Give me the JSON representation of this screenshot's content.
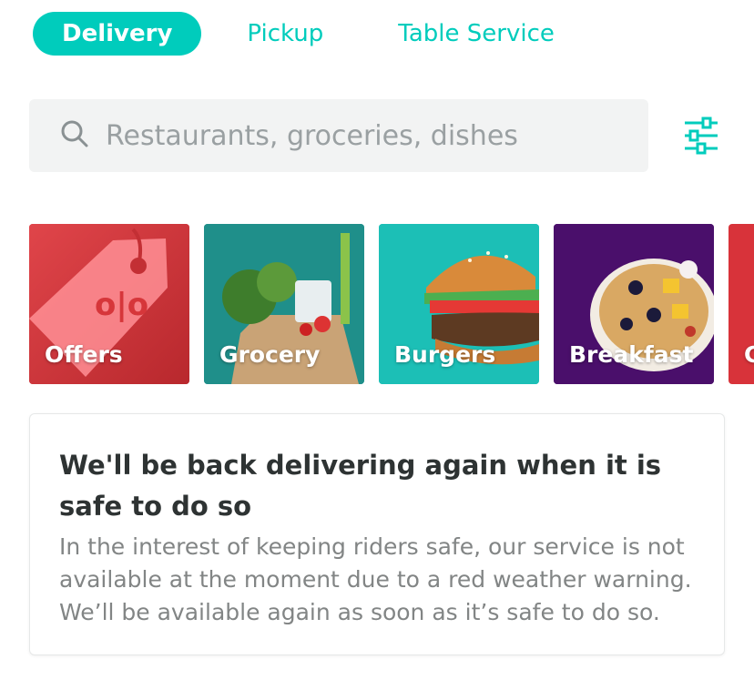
{
  "tabs": [
    {
      "label": "Delivery",
      "active": true
    },
    {
      "label": "Pickup",
      "active": false
    },
    {
      "label": "Table Service",
      "active": false
    }
  ],
  "search": {
    "placeholder": "Restaurants, groceries, dishes",
    "icon": "search-icon"
  },
  "filter": {
    "icon": "filter-sliders-icon"
  },
  "categories": [
    {
      "label": "Offers",
      "color": "#d6363a"
    },
    {
      "label": "Grocery",
      "color": "#1f8f8a"
    },
    {
      "label": "Burgers",
      "color": "#1cbfb6"
    },
    {
      "label": "Breakfast",
      "color": "#4a0f6b"
    },
    {
      "label": "C",
      "color": "#d8333a"
    }
  ],
  "notice": {
    "title": "We'll be back delivering again when it is safe to do so",
    "body": "In the interest of keeping riders safe, our service is not available at the moment due to a red weather warning. We’ll be available again as soon as it’s safe to do so."
  },
  "colors": {
    "accent": "#00ccbc",
    "text_dark": "#2e3333",
    "text_muted": "#828585"
  }
}
